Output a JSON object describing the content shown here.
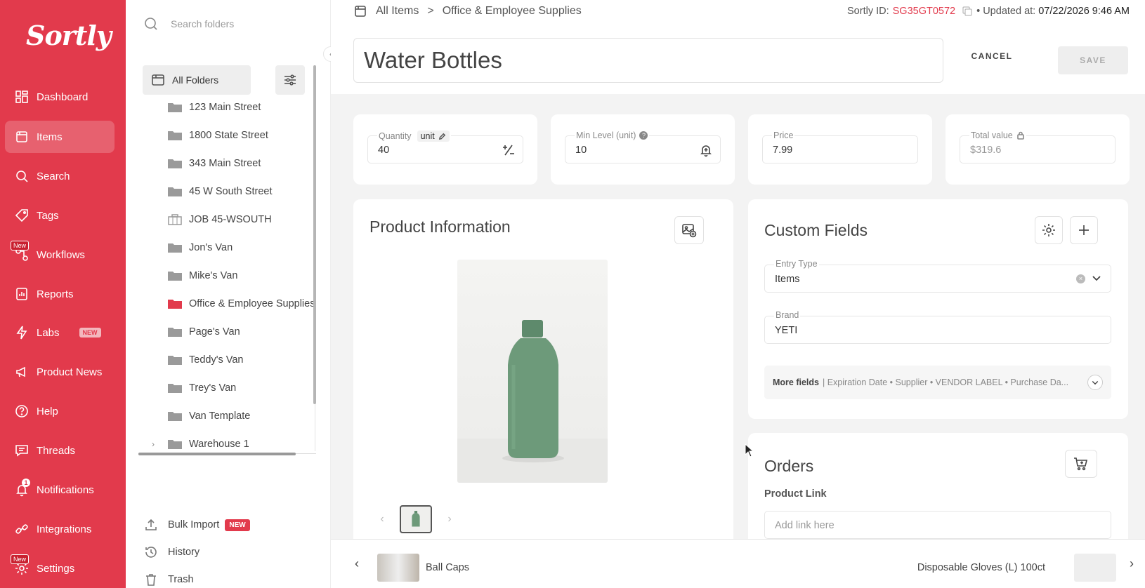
{
  "app": {
    "logo": "Sortly"
  },
  "sidebar": {
    "items": [
      {
        "label": "Dashboard",
        "icon": "dashboard-icon"
      },
      {
        "label": "Items",
        "icon": "items-icon",
        "active": true
      },
      {
        "label": "Search",
        "icon": "search-icon"
      },
      {
        "label": "Tags",
        "icon": "tag-icon"
      },
      {
        "label": "Workflows",
        "icon": "workflows-icon",
        "badge": "New"
      },
      {
        "label": "Reports",
        "icon": "reports-icon"
      },
      {
        "label": "Labs",
        "icon": "lightning-icon",
        "badge": "NEW"
      },
      {
        "label": "Product News",
        "icon": "megaphone-icon"
      },
      {
        "label": "Help",
        "icon": "help-icon"
      },
      {
        "label": "Threads",
        "icon": "threads-icon"
      },
      {
        "label": "Notifications",
        "icon": "bell-icon",
        "count": "1"
      },
      {
        "label": "Integrations",
        "icon": "integrations-icon"
      },
      {
        "label": "Settings",
        "icon": "gear-icon",
        "badge": "New"
      }
    ]
  },
  "folders": {
    "search_placeholder": "Search folders",
    "all_label": "All Folders",
    "list": [
      {
        "name": "123 Main Street"
      },
      {
        "name": "1800 State Street"
      },
      {
        "name": "343 Main Street"
      },
      {
        "name": "45 W South Street"
      },
      {
        "name": "JOB 45-WSOUTH"
      },
      {
        "name": "Jon's Van"
      },
      {
        "name": "Mike's Van"
      },
      {
        "name": "Office & Employee Supplies",
        "active": true
      },
      {
        "name": "Page's Van"
      },
      {
        "name": "Teddy's Van"
      },
      {
        "name": "Trey's Van"
      },
      {
        "name": "Van Template"
      },
      {
        "name": "Warehouse 1"
      }
    ],
    "bulk_import": "Bulk Import",
    "bulk_badge": "NEW",
    "history": "History",
    "trash": "Trash"
  },
  "header": {
    "crumb_root": "All Items",
    "crumb_sep": ">",
    "crumb_current": "Office & Employee Supplies",
    "sortly_id_label": "Sortly ID:",
    "sortly_id": "SG35GT0572",
    "updated_label": "• Updated at:",
    "updated_value": "07/22/2026 9:46 AM",
    "item_title": "Water Bottles",
    "cancel": "CANCEL",
    "save": "SAVE"
  },
  "stats": {
    "quantity_label": "Quantity",
    "unit_label": "unit",
    "quantity": "40",
    "min_label": "Min Level (unit)",
    "min_help": "?",
    "min_value": "10",
    "price_label": "Price",
    "price": "7.99",
    "total_label": "Total value",
    "total": "$319.6"
  },
  "product": {
    "title": "Product Information"
  },
  "custom_fields": {
    "title": "Custom Fields",
    "entry_type_label": "Entry Type",
    "entry_type_value": "Items",
    "brand_label": "Brand",
    "brand_value": "YETI",
    "more_label": "More fields",
    "more_list": "| Expiration Date • Supplier • VENDOR LABEL • Purchase Da..."
  },
  "orders": {
    "title": "Orders",
    "product_link_label": "Product Link",
    "link_placeholder": "Add link here"
  },
  "footer": {
    "prev_item": "Ball Caps",
    "next_item": "Disposable Gloves (L) 100ct"
  },
  "colors": {
    "brand": "#e23a4c",
    "folder": "#9a9a9a",
    "folder_active": "#e23a4c",
    "bottle": "#6d9a7a"
  }
}
